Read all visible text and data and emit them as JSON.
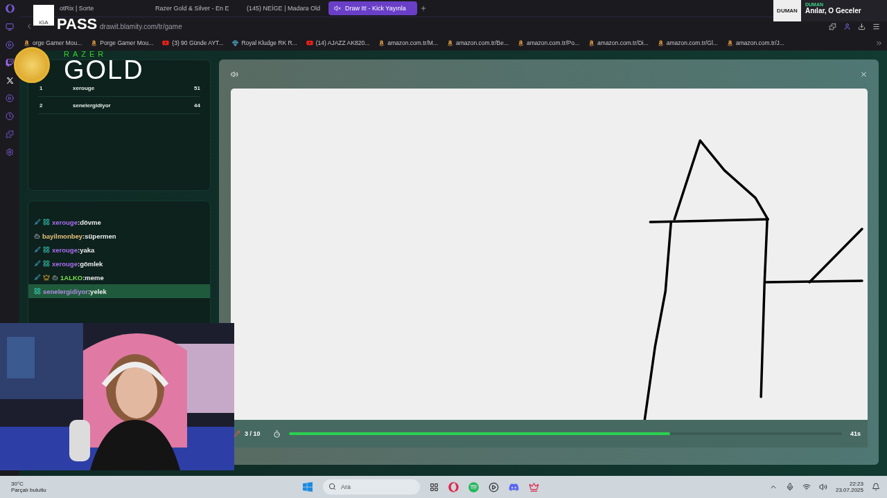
{
  "browser": {
    "tabs": [
      {
        "title": "otRix | Sorte",
        "kind": "plain",
        "selected": false
      },
      {
        "title": "Razer Gold & Silver - En E",
        "kind": "coin",
        "selected": false
      },
      {
        "title": "(145) NEİGE | Madara Old",
        "kind": "youtube",
        "selected": false
      },
      {
        "title": "Draw It! - Kick Yayınla",
        "kind": "muted",
        "selected": true
      }
    ],
    "address": "drawit.blamity.com/tr/game",
    "bookmarks": [
      {
        "title": "orge Gamer Mou...",
        "kind": "amazon"
      },
      {
        "title": "Porge Gamer Mou...",
        "kind": "amazon"
      },
      {
        "title": "(3) 90 Günde AYT...",
        "kind": "youtube"
      },
      {
        "title": "Royal Kludge RK R...",
        "kind": "diamond"
      },
      {
        "title": "(14) AJAZZ AK820...",
        "kind": "youtube"
      },
      {
        "title": "amazon.com.tr/M...",
        "kind": "amazon"
      },
      {
        "title": "amazon.com.tr/Be...",
        "kind": "amazon"
      },
      {
        "title": "amazon.com.tr/Po...",
        "kind": "amazon"
      },
      {
        "title": "amazon.com.tr/Di...",
        "kind": "amazon"
      },
      {
        "title": "amazon.com.tr/Gl...",
        "kind": "amazon"
      },
      {
        "title": "amazon.com.tr/J...",
        "kind": "amazon"
      }
    ]
  },
  "overlays": {
    "pass_logo": {
      "left": "iGA",
      "right": "PASS"
    },
    "razer_logo": {
      "brand": "RAZER",
      "title": "GOLD"
    },
    "now_playing": {
      "cover": "DUMAN",
      "artist": "DUMAN",
      "title": "Anılar, O Geceler"
    }
  },
  "leaderboard": [
    {
      "rank": "1",
      "name": "xerouge",
      "score": "51"
    },
    {
      "rank": "2",
      "name": "senelergidiyor",
      "score": "44"
    }
  ],
  "chat": [
    {
      "badges": [
        {
          "kind": "sword"
        },
        {
          "kind": "sub"
        }
      ],
      "user": "xerouge",
      "color": "#a86ef0",
      "text": ":dövme",
      "highlighted": false
    },
    {
      "badges": [
        {
          "kind": "bot"
        }
      ],
      "user": "bayilmonbey",
      "color": "#e6c27a",
      "text": ":süpermen",
      "highlighted": false
    },
    {
      "badges": [
        {
          "kind": "sword"
        },
        {
          "kind": "sub"
        }
      ],
      "user": "xerouge",
      "color": "#a86ef0",
      "text": ":yaka",
      "highlighted": false
    },
    {
      "badges": [
        {
          "kind": "sword"
        },
        {
          "kind": "sub"
        }
      ],
      "user": "xerouge",
      "color": "#a86ef0",
      "text": ":gömlek",
      "highlighted": false
    },
    {
      "badges": [
        {
          "kind": "sword"
        },
        {
          "kind": "crown"
        },
        {
          "kind": "bot"
        }
      ],
      "user": "1ALKO",
      "color": "#7be04a",
      "text": ":meme",
      "highlighted": false
    },
    {
      "badges": [
        {
          "kind": "sub"
        }
      ],
      "user": "senelergidiyor",
      "color": "#b08be0",
      "text": ":yelek",
      "highlighted": true
    }
  ],
  "game": {
    "round": "3 / 10",
    "timer": "41s",
    "level": 0.69
  },
  "taskbar": {
    "temperature": "30°C",
    "weather": "Parçalı bulutlu",
    "search_placeholder": "Ara",
    "time": "22:23",
    "date": "23.07.2025"
  }
}
